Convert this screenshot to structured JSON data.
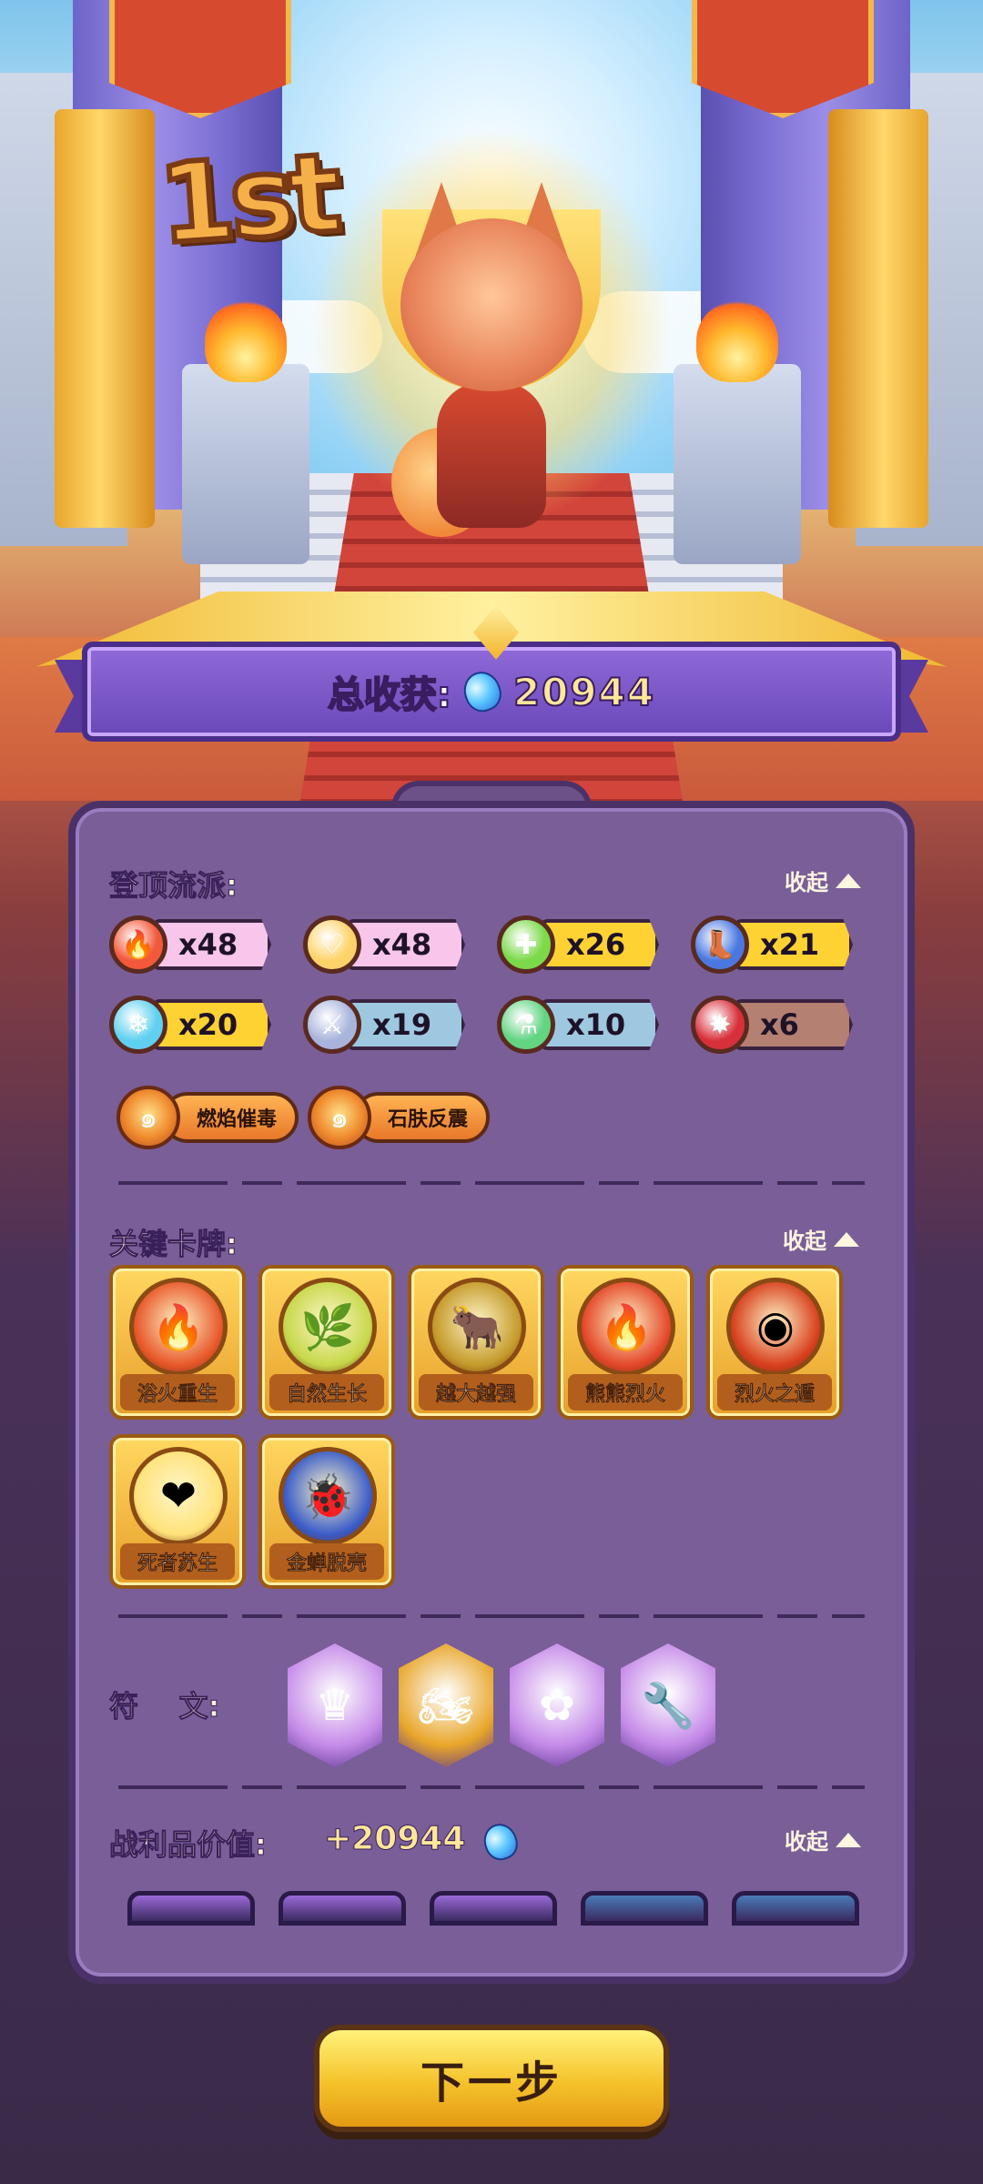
{
  "rank": "1st",
  "total": {
    "label": "总收获:",
    "value": "20944",
    "icon": "blue-gem-icon"
  },
  "style_section": {
    "title": "登顶流派:",
    "collapse_label": "收起",
    "stats": [
      {
        "icon": "flame-icon",
        "count": "x48",
        "icon_color": "#f2593a",
        "bar_color": "#f8c6ea"
      },
      {
        "icon": "heart-icon",
        "count": "x48",
        "icon_color": "#ffd36a",
        "bar_color": "#f8c6ea"
      },
      {
        "icon": "plus-icon",
        "count": "x26",
        "icon_color": "#7cd94a",
        "bar_color": "#ffd233"
      },
      {
        "icon": "boot-icon",
        "count": "x21",
        "icon_color": "#4a78e0",
        "bar_color": "#ffd233"
      },
      {
        "icon": "snowflake-icon",
        "count": "x20",
        "icon_color": "#5fd0f0",
        "bar_color": "#ffd233"
      },
      {
        "icon": "sword-icon",
        "count": "x19",
        "icon_color": "#a8b4dc",
        "bar_color": "#9ec8e0"
      },
      {
        "icon": "potion-icon",
        "count": "x10",
        "icon_color": "#62d482",
        "bar_color": "#9ec8e0"
      },
      {
        "icon": "burst-icon",
        "count": "x6",
        "icon_color": "#d8303a",
        "bar_color": "#b48072"
      }
    ],
    "tags": [
      {
        "icon": "swirl-icon",
        "label": "燃焰催毒"
      },
      {
        "icon": "swirl-icon",
        "label": "石肤反震"
      }
    ]
  },
  "cards_section": {
    "title": "关键卡牌:",
    "collapse_label": "收起",
    "cards": [
      {
        "name": "浴火重生",
        "icon": "phoenix-flame-icon",
        "art_color": "#e8582a"
      },
      {
        "name": "自然生长",
        "icon": "vine-icon",
        "art_color": "#c7d84a"
      },
      {
        "name": "越大越强",
        "icon": "bull-icon",
        "art_color": "#c49a2a"
      },
      {
        "name": "熊熊烈火",
        "icon": "blaze-icon",
        "art_color": "#e4482a"
      },
      {
        "name": "烈火之遁",
        "icon": "fire-orb-icon",
        "art_color": "#d8401e"
      },
      {
        "name": "死者苏生",
        "icon": "winged-heart-icon",
        "art_color": "#ffe27a"
      },
      {
        "name": "金蝉脱壳",
        "icon": "cicada-icon",
        "art_color": "#3a5cc8"
      }
    ]
  },
  "runes_section": {
    "title": "符    文:",
    "runes": [
      {
        "icon": "idol-rune-icon",
        "color": "#c58ae8"
      },
      {
        "icon": "motorcycle-rune-icon",
        "color": "#e8a62a"
      },
      {
        "icon": "rose-rune-icon",
        "color": "#c58ae8"
      },
      {
        "icon": "wrench-rune-icon",
        "color": "#c58ae8"
      }
    ]
  },
  "loot_section": {
    "title": "战利品价值:",
    "value": "+20944",
    "collapse_label": "收起",
    "items": [
      {
        "color": "#9a6ad8"
      },
      {
        "color": "#9a6ad8"
      },
      {
        "color": "#9a6ad8"
      },
      {
        "color": "#4a7ab8"
      },
      {
        "color": "#4a7ab8"
      }
    ]
  },
  "next_button": {
    "label": "下一步"
  }
}
